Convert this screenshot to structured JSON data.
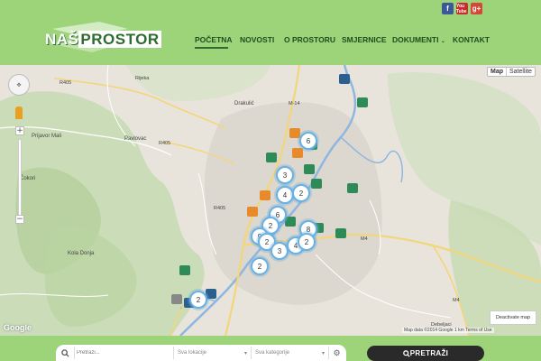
{
  "header": {
    "logo": {
      "part1": "NAŠ",
      "part2": "PROSTOR"
    },
    "social": {
      "facebook": "f",
      "youtube": "You Tube",
      "googleplus": "g+"
    },
    "nav": [
      {
        "label": "POČETNA",
        "active": true
      },
      {
        "label": "NOVOSTI"
      },
      {
        "label": "O PROSTORU"
      },
      {
        "label": "SMJERNICE"
      },
      {
        "label": "DOKUMENTI"
      },
      {
        "label": "KONTAKT"
      }
    ]
  },
  "map": {
    "maptype": {
      "map": "Map",
      "satellite": "Satellite"
    },
    "deactivate": "Deactivate map",
    "google": "Google",
    "attribution": "Map data ©2014 Google   1 km      Terms of Use",
    "labels": {
      "r405a": "R405",
      "rijeka": "Rijeka",
      "drakulic": "Drakulić",
      "m14": "M-14",
      "prijavor": "Prijavor Mali",
      "pavlovac": "Pavlovac",
      "r405b": "R405",
      "cokori": "Čokori",
      "r405c": "R405",
      "kola": "Kola Donja",
      "m4": "M4",
      "m4b": "M4",
      "dabrac": "Debeljaci"
    },
    "clusters": [
      "6",
      "3",
      "4",
      "2",
      "6",
      "2",
      "9",
      "2",
      "3",
      "4",
      "8",
      "2",
      "2",
      "2"
    ]
  },
  "search": {
    "placeholder": "Pretraži...",
    "location": "Sva lokacije",
    "category": "Sva kategorije",
    "button": "PRETRAŽI"
  },
  "colors": {
    "header": "#9dd47a",
    "accent": "#2e6b2e",
    "cluster_ring": "#6ab0e0"
  }
}
